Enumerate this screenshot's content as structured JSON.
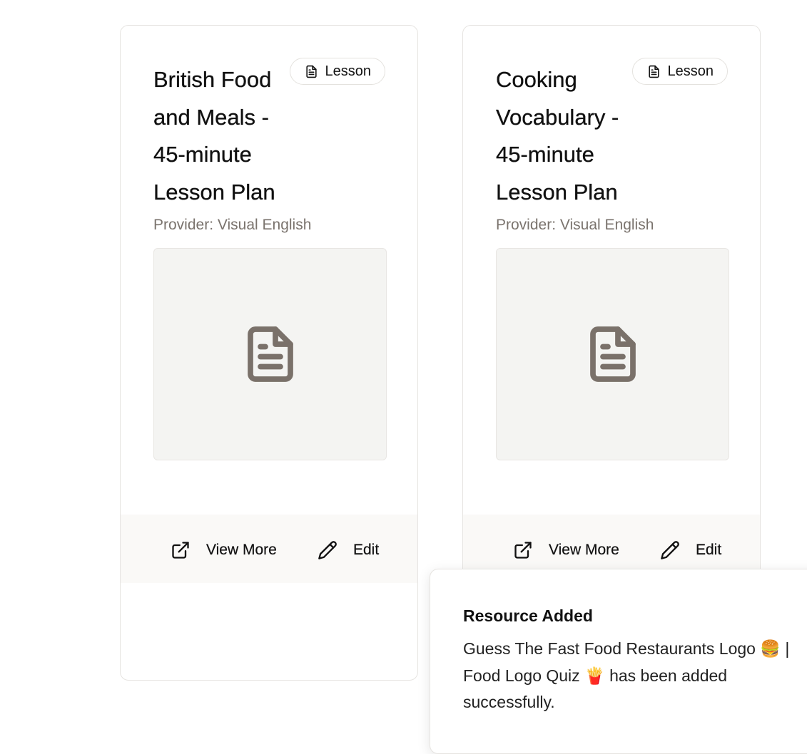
{
  "cards": [
    {
      "title": "British Food and Meals - 45-minute Lesson Plan",
      "badge": {
        "label": "Lesson",
        "icon": "document-icon"
      },
      "provider": "Provider: Visual English",
      "thumbnail_icon": "document-icon",
      "actions": {
        "view_more": "View More",
        "edit": "Edit"
      }
    },
    {
      "title": "Cooking Vocabulary - 45-minute Lesson Plan",
      "badge": {
        "label": "Lesson",
        "icon": "document-icon"
      },
      "provider": "Provider: Visual English",
      "thumbnail_icon": "document-icon",
      "actions": {
        "view_more": "View More",
        "edit": "Edit"
      }
    }
  ],
  "toast": {
    "title": "Resource Added",
    "message": "Guess The Fast Food Restaurants Logo 🍔 | Food Logo Quiz 🍟 has been added successfully."
  },
  "colors": {
    "card_border": "#e6e4e1",
    "thumbnail_bg": "#f4f4f2",
    "icon_gray": "#7a716a",
    "provider_text": "#7a736d",
    "footer_bg": "#faf9f7"
  }
}
